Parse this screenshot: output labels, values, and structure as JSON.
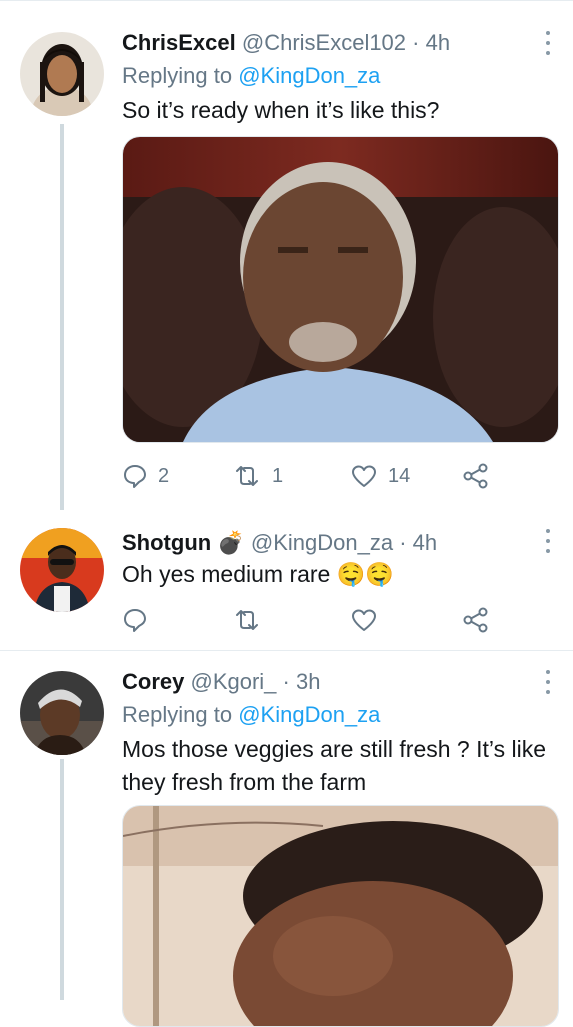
{
  "tweets": [
    {
      "name": "ChrisExcel",
      "handle": "@ChrisExcel102",
      "time": "· 4h",
      "replying_prefix": "Replying to",
      "replying_to": "@KingDon_za",
      "text": "So it’s ready when it’s like this?",
      "replies": "2",
      "retweets": "1",
      "likes": "14"
    },
    {
      "name": "Shotgun",
      "name_emoji": "💣",
      "handle": "@KingDon_za",
      "time": "· 4h",
      "text": "Oh yes medium rare 🤤🤤",
      "replies": "",
      "retweets": "",
      "likes": ""
    },
    {
      "name": "Corey",
      "handle": "@Kgori_",
      "time": "· 3h",
      "replying_prefix": "Replying to",
      "replying_to": "@KingDon_za",
      "text_line1": "Mos those veggies are still fresh ? It’s like",
      "text_line2": "they fresh from the farm"
    }
  ],
  "icons": {
    "reply": "reply-icon",
    "retweet": "retweet-icon",
    "like": "heart-icon",
    "share": "share-icon",
    "more": "more-vertical-icon"
  },
  "colors": {
    "link": "#1da1f2",
    "secondary": "#657786",
    "icon": "#657786"
  }
}
